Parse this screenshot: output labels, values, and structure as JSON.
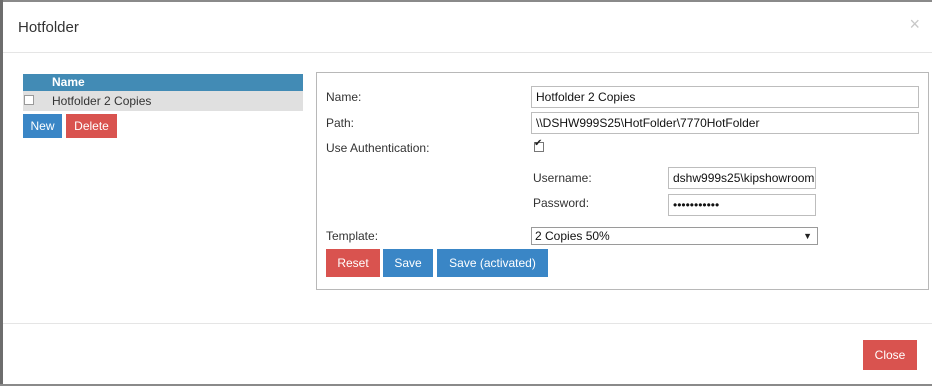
{
  "dialog": {
    "title": "Hotfolder",
    "close_icon": "×"
  },
  "list": {
    "column_header": "Name",
    "rows": [
      {
        "label": "Hotfolder 2 Copies"
      }
    ],
    "new_label": "New",
    "delete_label": "Delete"
  },
  "form": {
    "name_label": "Name:",
    "name_value": "Hotfolder 2 Copies",
    "path_label": "Path:",
    "path_value": "\\\\DSHW999S25\\HotFolder\\7770HotFolder",
    "auth_label": "Use Authentication:",
    "auth_checked": true,
    "username_label": "Username:",
    "username_value": "dshw999s25\\kipshowroom",
    "password_label": "Password:",
    "password_value": "•••••••••••",
    "template_label": "Template:",
    "template_value": "2 Copies 50%",
    "reset_label": "Reset",
    "save_label": "Save",
    "save_activated_label": "Save (activated)"
  },
  "footer": {
    "close_label": "Close"
  },
  "colors": {
    "primary": "#3a86c6",
    "danger": "#d9534f",
    "header": "#428bb5"
  }
}
